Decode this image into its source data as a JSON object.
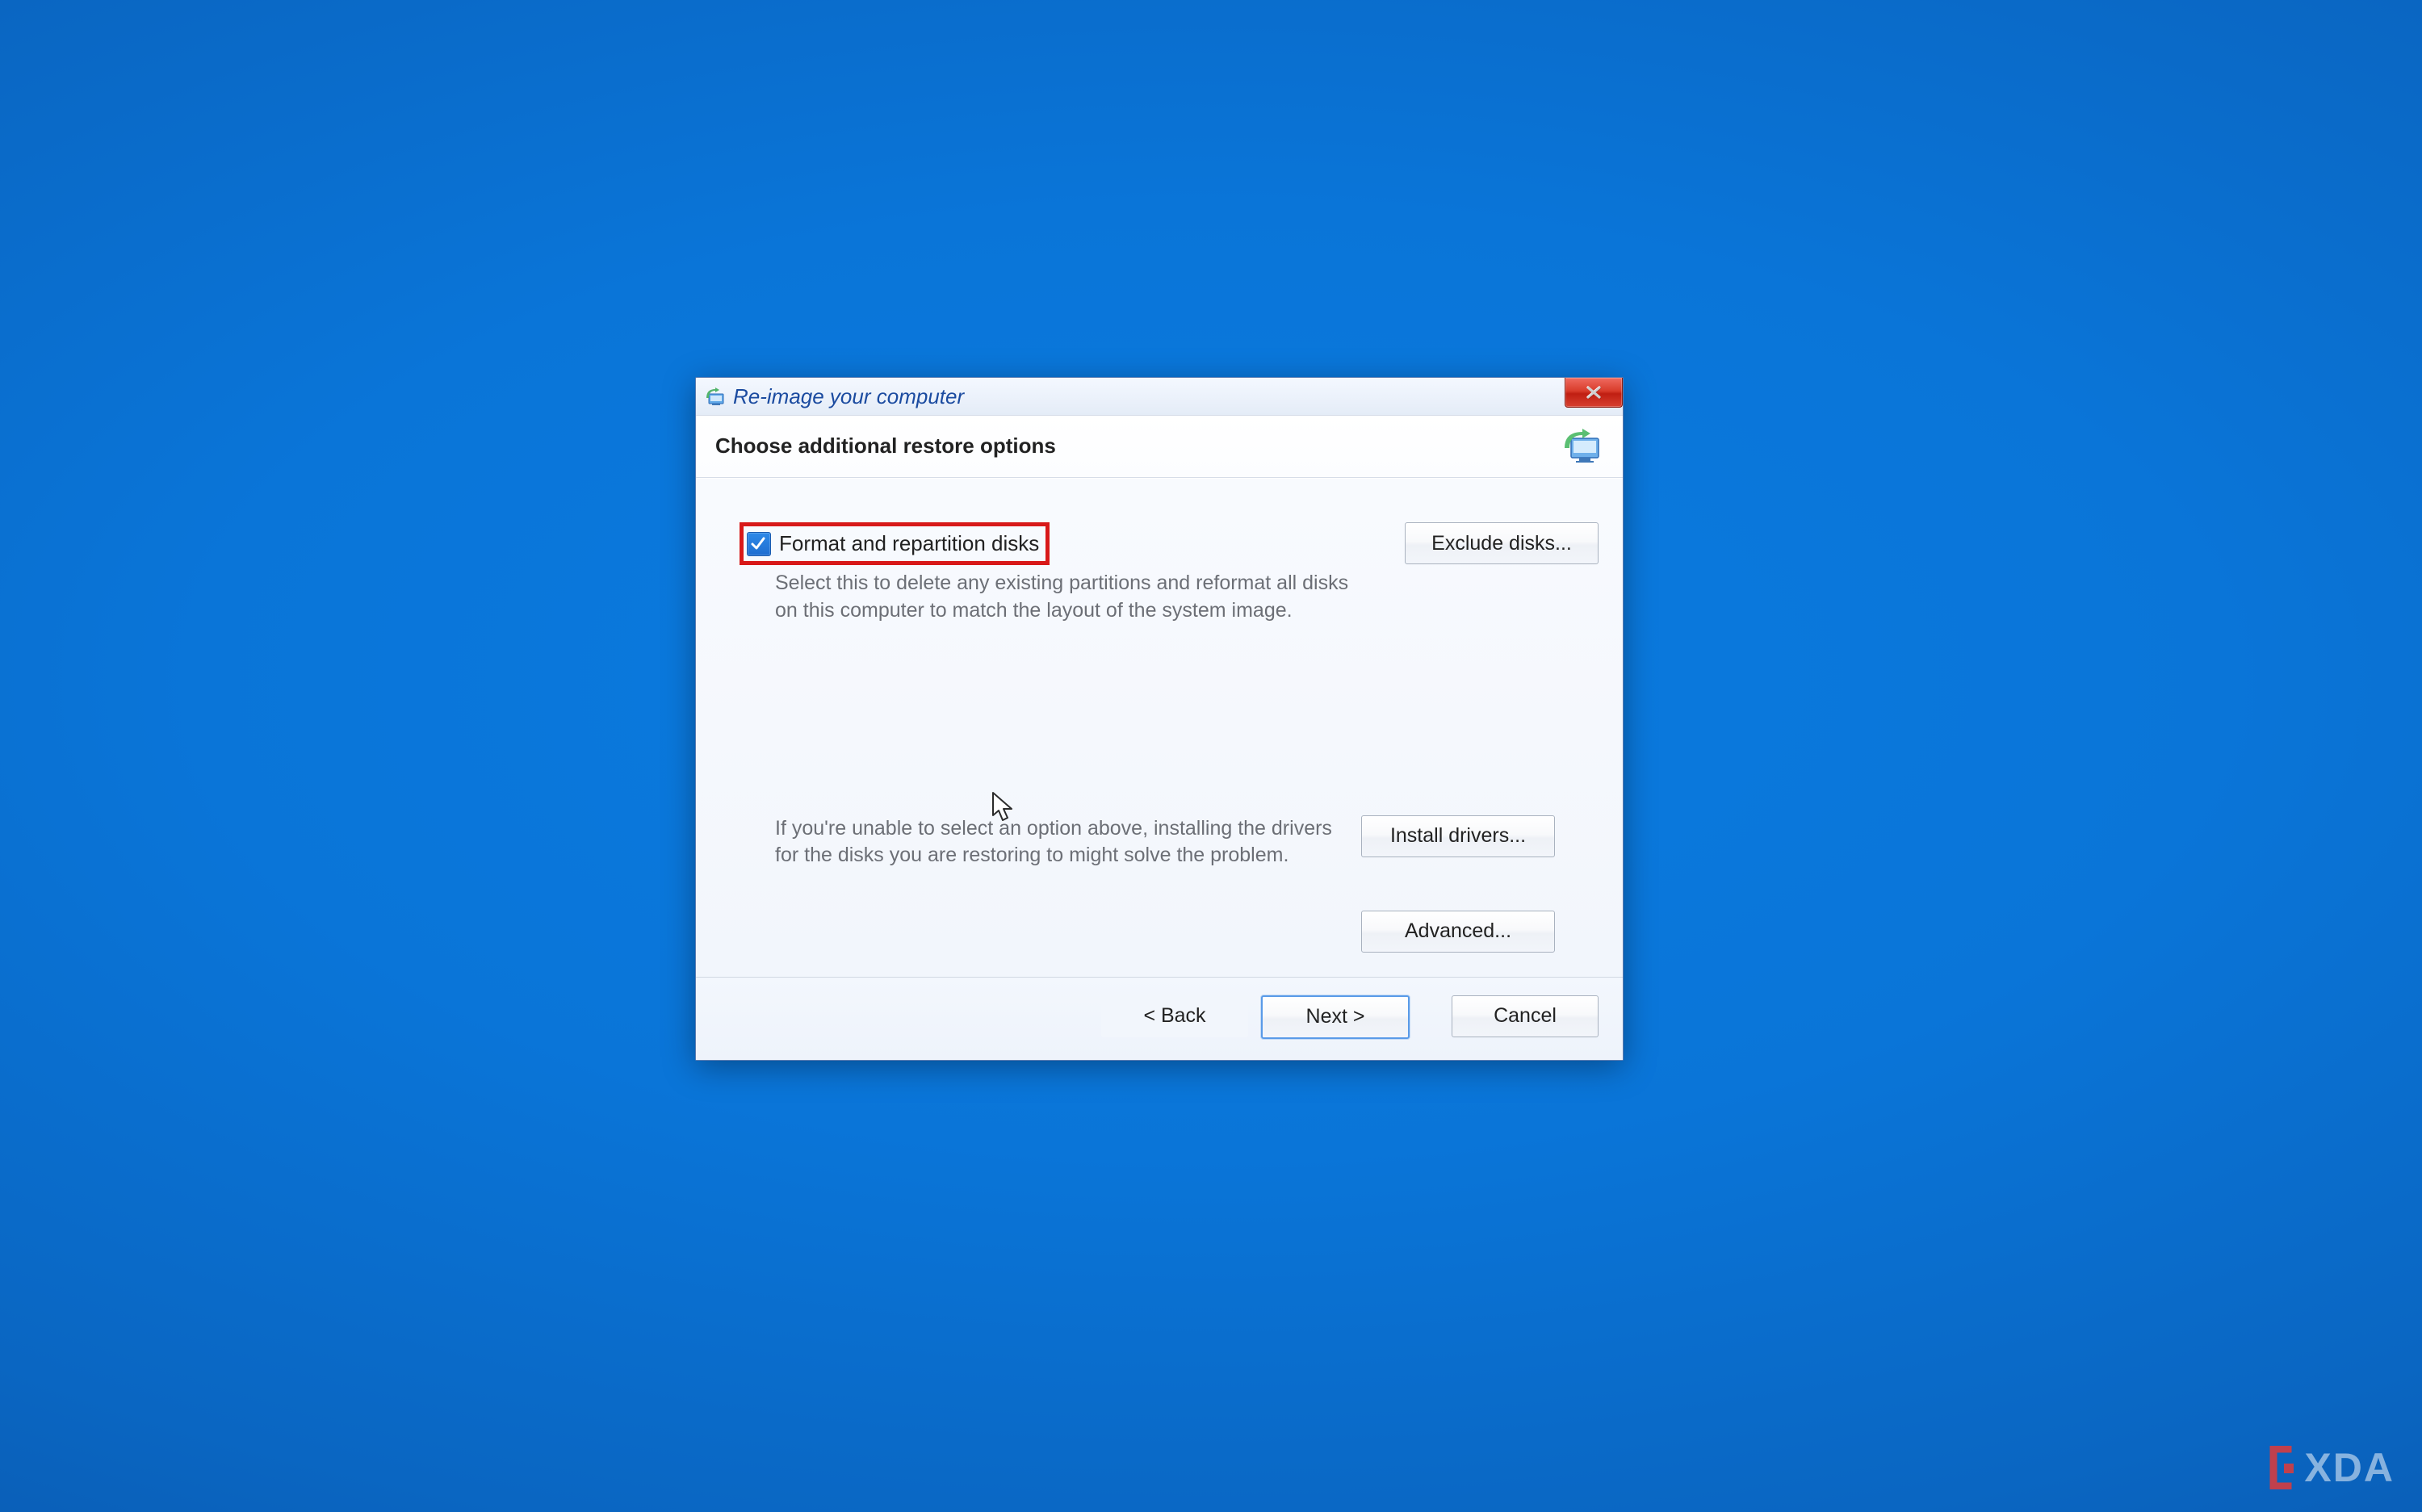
{
  "window": {
    "title": "Re-image your computer",
    "subtitle": "Choose additional restore options"
  },
  "option": {
    "checkbox_label": "Format and repartition disks",
    "checkbox_checked": true,
    "description": "Select this to delete any existing partitions and reformat all disks on this computer to match the layout of the system image."
  },
  "help": {
    "text": "If you're unable to select an option above, installing the drivers for the disks you are restoring to might solve the problem."
  },
  "buttons": {
    "exclude_disks": "Exclude disks...",
    "install_drivers": "Install drivers...",
    "advanced": "Advanced...",
    "back": "< Back",
    "next": "Next >",
    "cancel": "Cancel"
  },
  "watermark": {
    "text": "XDA"
  }
}
